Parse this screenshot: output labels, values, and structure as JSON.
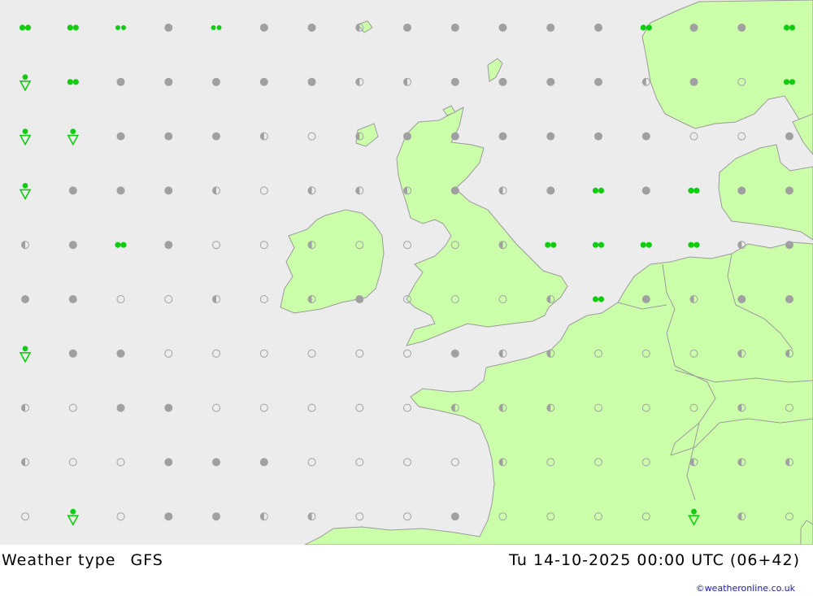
{
  "header": {
    "product": "Weather type",
    "model": "GFS",
    "valid_time": "Tu 14-10-2025 00:00 UTC (06+42)",
    "credit": "©weatheronline.co.uk"
  },
  "colors": {
    "sea": "#ececec",
    "land": "#ccffaa",
    "coast": "#9a9a9a",
    "symbol_grey": "#a0a0a0",
    "symbol_green": "#11cc11"
  },
  "symbol_legend": {
    "O": "clear",
    "H": "partly cloudy",
    "F": "overcast",
    "R": "rain",
    "r": "light rain",
    "S": "showers"
  },
  "grid": {
    "columns": 17,
    "rows": 10,
    "cells": [
      "RRrFrFFHFFFFFRFFR",
      "SRFFFFFHHFFFFHFOR",
      "SSFFFHOHFFFFFFOOF",
      "SFFFHOHHHFHFRFRFF",
      "HFRFOOHOOOHRRRRHF",
      "FFOOHOHFOOOHRFHFF",
      "SFFOOOOOOFHHOOOHH",
      "HOFFOOOOOHHHOOOHO",
      "HOOFFFOOOOHOOOHHH",
      "OSOFFHHOOFOOOOSHO"
    ]
  }
}
